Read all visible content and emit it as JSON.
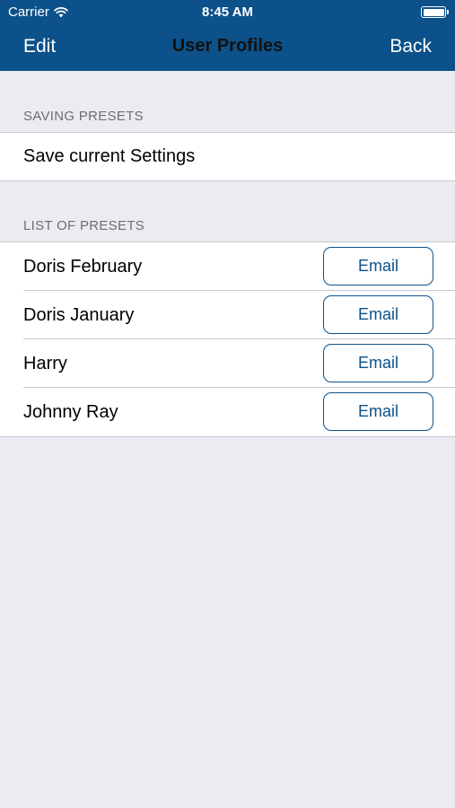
{
  "status_bar": {
    "carrier": "Carrier",
    "time": "8:45 AM",
    "wifi_icon": "wifi-icon",
    "battery_icon": "battery-icon"
  },
  "nav": {
    "left_button": "Edit",
    "title": "User Profiles",
    "right_button": "Back"
  },
  "saving_section": {
    "header": "SAVING PRESETS",
    "items": [
      {
        "label": "Save current Settings"
      }
    ]
  },
  "presets_section": {
    "header": "LIST OF PRESETS",
    "items": [
      {
        "name": "Doris February",
        "button": "Email"
      },
      {
        "name": "Doris January",
        "button": "Email"
      },
      {
        "name": "Harry",
        "button": "Email"
      },
      {
        "name": "Johnny Ray",
        "button": "Email"
      }
    ]
  },
  "colors": {
    "nav_background": "#0c5189",
    "accent": "#0c5189",
    "page_background": "#ebebf1",
    "section_header_text": "#6d6d72"
  }
}
